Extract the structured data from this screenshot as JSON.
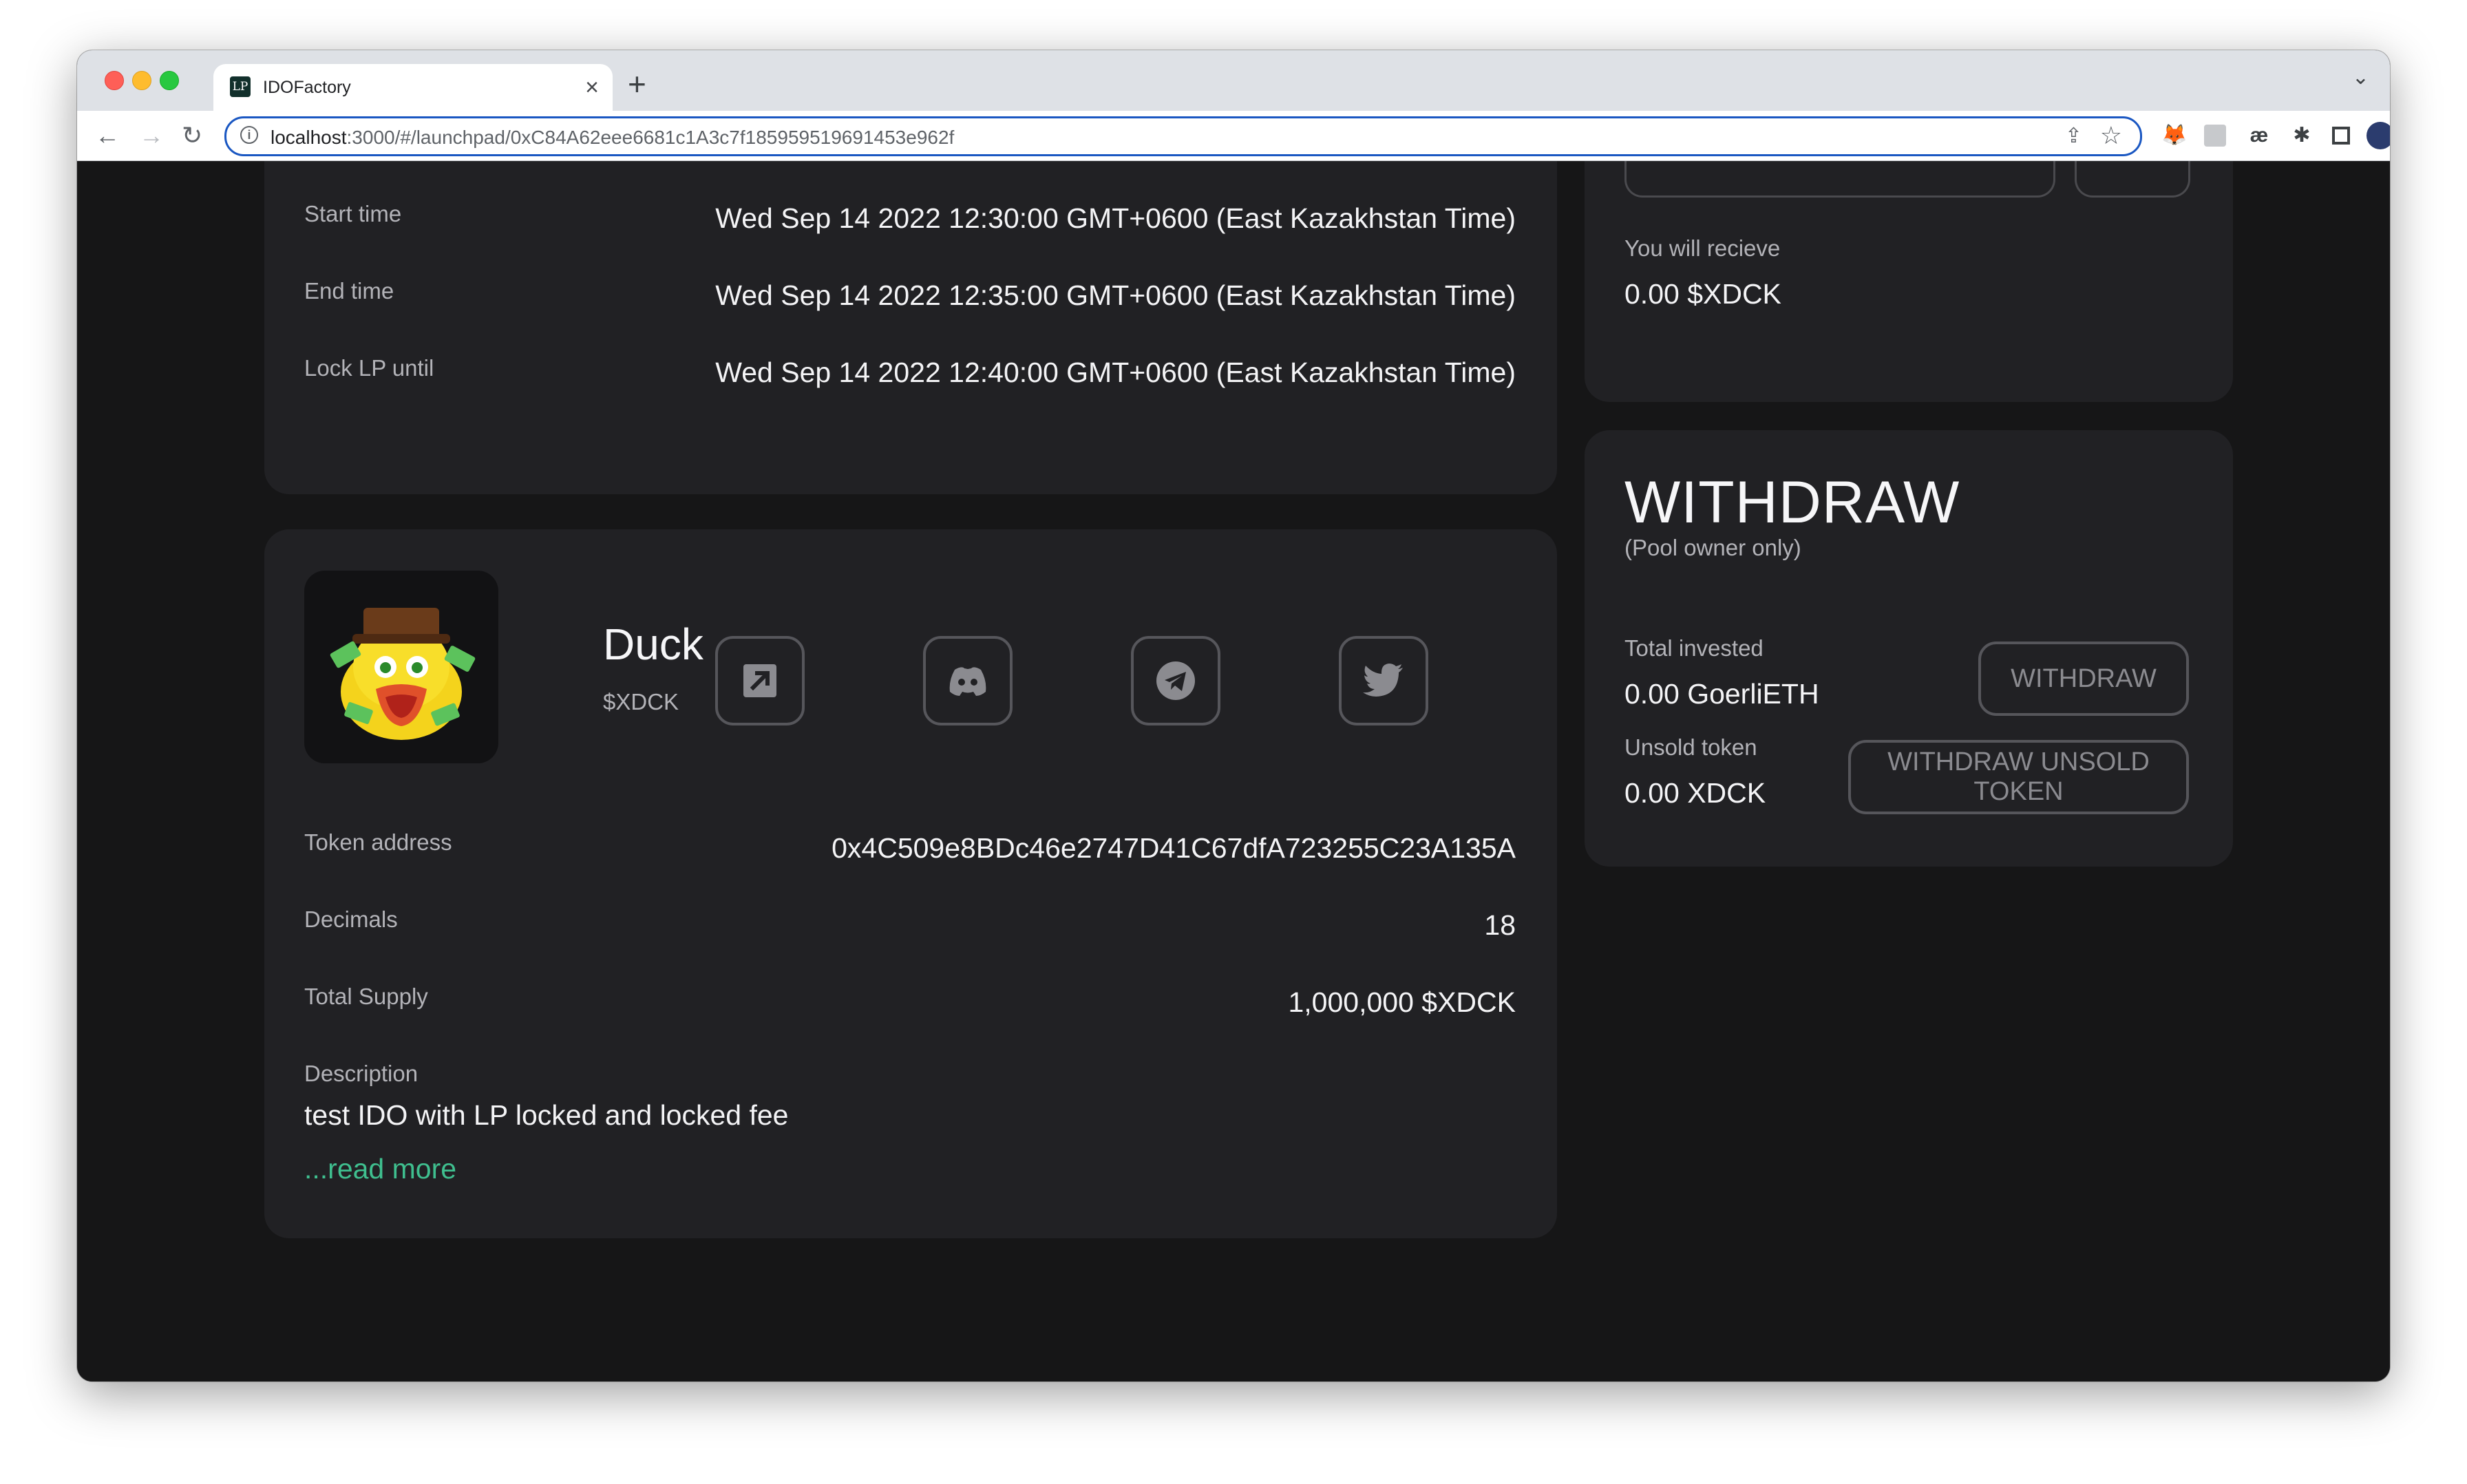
{
  "browser": {
    "tab_title": "IDOFactory",
    "tab_favicon": "LP",
    "url_host": "localhost",
    "url_path": ":3000/#/launchpad/0xC84A62eee6681c1A3c7f185959519691453e962f"
  },
  "schedule": {
    "rows": [
      {
        "label": "Start time",
        "value": "Wed Sep 14 2022 12:30:00 GMT+0600 (East Kazakhstan Time)"
      },
      {
        "label": "End time",
        "value": "Wed Sep 14 2022 12:35:00 GMT+0600 (East Kazakhstan Time)"
      },
      {
        "label": "Lock LP until",
        "value": "Wed Sep 14 2022 12:40:00 GMT+0600 (East Kazakhstan Time)"
      }
    ]
  },
  "buy": {
    "receive_label": "You will recieve",
    "receive_value": "0.00 $XDCK"
  },
  "withdraw": {
    "title": "WITHDRAW",
    "subtitle": "(Pool owner only)",
    "invested_label": "Total invested",
    "invested_value": "0.00 GoerliETH",
    "withdraw_button": "WITHDRAW",
    "unsold_label": "Unsold token",
    "unsold_value": "0.00 XDCK",
    "withdraw_unsold_button": "WITHDRAW UNSOLD TOKEN"
  },
  "token": {
    "name": "Duck",
    "symbol": "$XDCK",
    "socials": [
      "external-link-icon",
      "discord-icon",
      "telegram-icon",
      "twitter-icon"
    ],
    "address_label": "Token address",
    "address_value": "0x4C509e8BDc46e2747D41C67dfA723255C23A135A",
    "decimals_label": "Decimals",
    "decimals_value": "18",
    "supply_label": "Total Supply",
    "supply_value": "1,000,000 $XDCK",
    "description_label": "Description",
    "description_value": "test IDO with LP locked and locked fee",
    "read_more": "...read more"
  },
  "colors": {
    "background": "#161617",
    "card": "#212124",
    "accent_link": "#3fbf8f",
    "url_focus": "#1a57c2"
  }
}
